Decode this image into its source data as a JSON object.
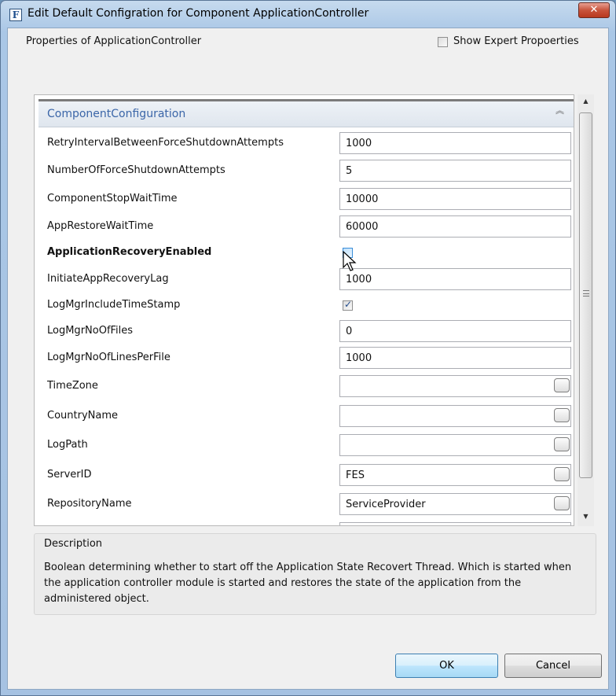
{
  "window": {
    "title": "Edit Default Configration for Component ApplicationController",
    "icon_letter": "F",
    "close_glyph": "✕"
  },
  "header": {
    "properties_label": "Properties of ApplicationController",
    "expert_label": "Show Expert Propoerties",
    "expert_checked": false
  },
  "group": {
    "title": "ComponentConfiguration",
    "collapse_glyph": "︽"
  },
  "rows": [
    {
      "label": "RetryIntervalBetweenForceShutdownAttempts",
      "value": "1000"
    },
    {
      "label": "NumberOfForceShutdownAttempts",
      "value": "5"
    },
    {
      "label": "ComponentStopWaitTime",
      "value": "10000"
    },
    {
      "label": "AppRestoreWaitTime",
      "value": "60000"
    },
    {
      "label": "ApplicationRecoveryEnabled",
      "checked": false
    },
    {
      "label": "InitiateAppRecoveryLag",
      "value": "1000"
    },
    {
      "label": "LogMgrIncludeTimeStamp",
      "checked": true
    },
    {
      "label": "LogMgrNoOfFiles",
      "value": "0"
    },
    {
      "label": "LogMgrNoOfLinesPerFile",
      "value": "1000"
    },
    {
      "label": "TimeZone",
      "value": ""
    },
    {
      "label": "CountryName",
      "value": ""
    },
    {
      "label": "LogPath",
      "value": ""
    },
    {
      "label": "ServerID",
      "value": "FES"
    },
    {
      "label": "RepositoryName",
      "value": "ServiceProvider"
    }
  ],
  "description": {
    "title": "Description",
    "text": "Boolean determining whether to start off the Application State Recovert Thread. Which is started when the application controller module is started and restores the state of the application from the administered object."
  },
  "buttons": {
    "ok": "OK",
    "cancel": "Cancel"
  },
  "colors": {
    "group_title": "#3b66a8",
    "title_bar": "#aac7e6",
    "close_button": "#c8533c"
  }
}
